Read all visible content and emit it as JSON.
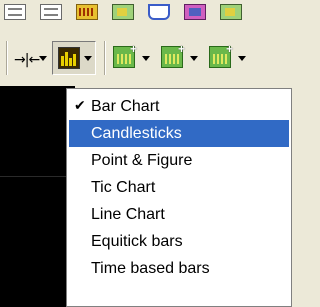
{
  "toolbar": {
    "top_icons": [
      "lines-icon",
      "lines-icon",
      "gold-chart-icon",
      "green-chart-icon",
      "blue-chart-icon",
      "pink-chart-icon",
      "chart-icon"
    ],
    "zoom_glyph": "→|←",
    "buttons": [
      "zoom-button",
      "chart-type-button",
      "add-study-button",
      "add-study-button",
      "add-study-button"
    ]
  },
  "menu": {
    "items": [
      {
        "label": "Bar Chart",
        "checked": true,
        "highlighted": false
      },
      {
        "label": "Candlesticks",
        "checked": false,
        "highlighted": true
      },
      {
        "label": "Point & Figure",
        "checked": false,
        "highlighted": false
      },
      {
        "label": "Tic Chart",
        "checked": false,
        "highlighted": false
      },
      {
        "label": "Line Chart",
        "checked": false,
        "highlighted": false
      },
      {
        "label": "Equitick bars",
        "checked": false,
        "highlighted": false
      },
      {
        "label": "Time based bars",
        "checked": false,
        "highlighted": false
      }
    ],
    "check_glyph": "✔"
  },
  "colors": {
    "highlight": "#316ac5",
    "toolbar_bg": "#ece9d8",
    "chart_bg": "#000000"
  }
}
